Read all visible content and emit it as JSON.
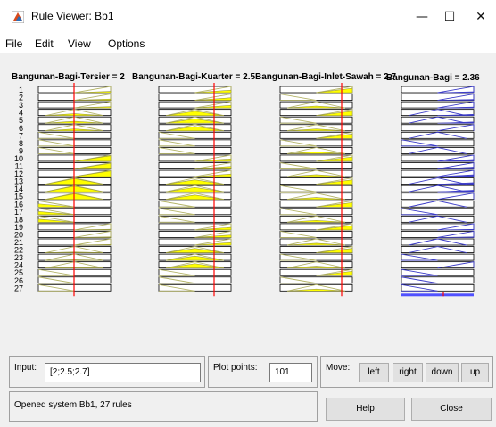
{
  "window": {
    "title": "Rule Viewer: Bb1",
    "minimize_glyph": "—",
    "maximize_glyph": "☐",
    "close_glyph": "✕"
  },
  "menu": [
    "File",
    "Edit",
    "View",
    "Options"
  ],
  "headers": {
    "input1": "Bangunan-Bagi-Tersier = 2",
    "input2": "Bangunan-Bagi-Kuarter = 2.5",
    "input3": "Bangunan-Bagi-Inlet-Sawah = 2.7",
    "output": "Bangunan-Bagi = 2.36"
  },
  "rule_numbers": [
    "1",
    "2",
    "3",
    "4",
    "5",
    "6",
    "7",
    "8",
    "9",
    "10",
    "11",
    "12",
    "13",
    "14",
    "15",
    "16",
    "17",
    "18",
    "19",
    "20",
    "21",
    "22",
    "23",
    "24",
    "25",
    "26",
    "27"
  ],
  "controls": {
    "input_label": "Input:",
    "input_value": "[2;2.5;2.7]",
    "plot_points_label": "Plot points:",
    "plot_points_value": "101",
    "move_label": "Move:",
    "left": "left",
    "right": "right",
    "down": "down",
    "up": "up",
    "status": "Opened system Bb1, 27 rules",
    "help": "Help",
    "close": "Close"
  },
  "colors": {
    "membership_fill": "#ffff00",
    "membership_line": "#b5b56a",
    "output_line": "#3c3cc8",
    "input_marker": "#ff0000",
    "panel_bg": "#f0f0f0"
  }
}
